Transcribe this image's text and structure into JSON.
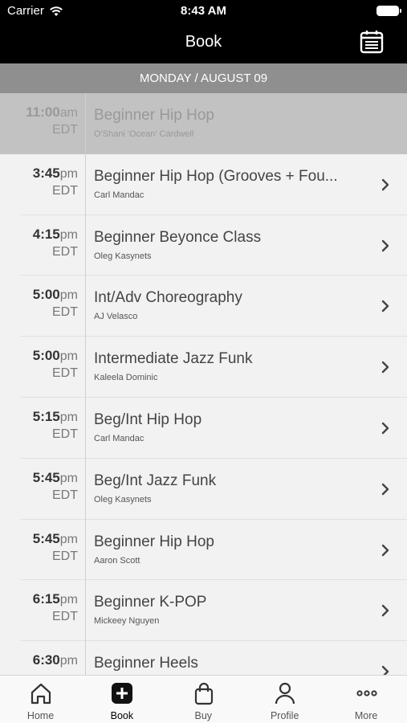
{
  "status_bar": {
    "carrier": "Carrier",
    "time": "8:43 AM"
  },
  "nav": {
    "title": "Book"
  },
  "date_header": "MONDAY / AUGUST 09",
  "classes": [
    {
      "hm": "11:00",
      "ampm": "am",
      "tz": "EDT",
      "name": "Beginner Hip Hop",
      "instructor": "O'Shani 'Ocean' Cardwell",
      "past": true
    },
    {
      "hm": "3:45",
      "ampm": "pm",
      "tz": "EDT",
      "name": "Beginner Hip Hop (Grooves + Fou...",
      "instructor": "Carl Mandac",
      "past": false
    },
    {
      "hm": "4:15",
      "ampm": "pm",
      "tz": "EDT",
      "name": "Beginner Beyonce Class",
      "instructor": "Oleg Kasynets",
      "past": false
    },
    {
      "hm": "5:00",
      "ampm": "pm",
      "tz": "EDT",
      "name": "Int/Adv Choreography",
      "instructor": "AJ Velasco",
      "past": false
    },
    {
      "hm": "5:00",
      "ampm": "pm",
      "tz": "EDT",
      "name": "Intermediate Jazz Funk",
      "instructor": "Kaleela Dominic",
      "past": false
    },
    {
      "hm": "5:15",
      "ampm": "pm",
      "tz": "EDT",
      "name": "Beg/Int Hip Hop",
      "instructor": "Carl Mandac",
      "past": false
    },
    {
      "hm": "5:45",
      "ampm": "pm",
      "tz": "EDT",
      "name": "Beg/Int Jazz Funk",
      "instructor": "Oleg Kasynets",
      "past": false
    },
    {
      "hm": "5:45",
      "ampm": "pm",
      "tz": "EDT",
      "name": "Beginner Hip Hop",
      "instructor": "Aaron Scott",
      "past": false
    },
    {
      "hm": "6:15",
      "ampm": "pm",
      "tz": "EDT",
      "name": "Beginner K-POP",
      "instructor": "Mickeey Nguyen",
      "past": false
    },
    {
      "hm": "6:30",
      "ampm": "pm",
      "tz": "",
      "name": "Beginner Heels",
      "instructor": "",
      "past": false
    }
  ],
  "tabs": [
    {
      "label": "Home",
      "icon": "home-icon",
      "active": false
    },
    {
      "label": "Book",
      "icon": "plus-square-icon",
      "active": true
    },
    {
      "label": "Buy",
      "icon": "shopping-bag-icon",
      "active": false
    },
    {
      "label": "Profile",
      "icon": "person-icon",
      "active": false
    },
    {
      "label": "More",
      "icon": "more-dots-icon",
      "active": false
    }
  ],
  "colors": {
    "nav_bg": "#000000",
    "date_header_bg": "#8f8f8f",
    "past_row_bg": "#c2c2c2",
    "list_bg": "#f2f2f2"
  }
}
